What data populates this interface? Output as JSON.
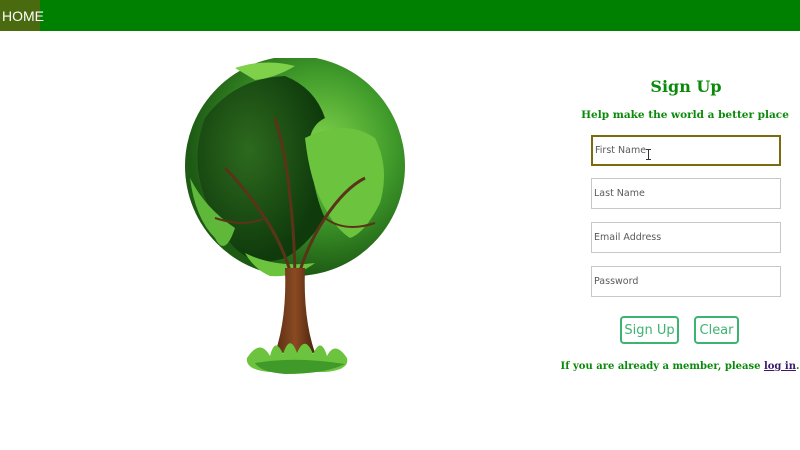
{
  "nav": {
    "home_label": "HOME"
  },
  "form": {
    "title": "Sign Up",
    "subtitle": "Help make the world a better place",
    "first_name": {
      "placeholder": "First Name",
      "value": ""
    },
    "last_name": {
      "placeholder": "Last Name",
      "value": ""
    },
    "email": {
      "placeholder": "Email Address",
      "value": ""
    },
    "password": {
      "placeholder": "Password",
      "value": ""
    },
    "signup_label": "Sign Up",
    "clear_label": "Clear",
    "member_prefix": "If you are already a member, please ",
    "login_label": "log in",
    "member_suffix": "."
  },
  "colors": {
    "nav_bar": "#008000",
    "home_highlight": "#4a6a10",
    "heading_green": "#0a8a0a",
    "button_green": "#3cb371",
    "focus_border": "#7a6a10"
  },
  "icons": {
    "illustration": "earth-tree-illustration",
    "text_cursor": "text-cursor-icon"
  }
}
